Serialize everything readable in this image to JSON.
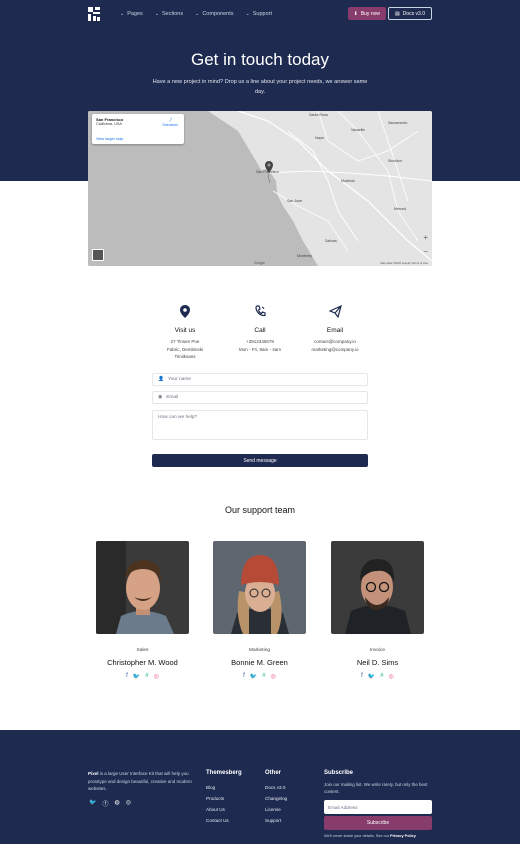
{
  "nav": {
    "links": [
      "Pages",
      "Sections",
      "Components",
      "Support"
    ],
    "buy_label": "Buy now",
    "docs_label": "Docs v3.0"
  },
  "hero": {
    "title": "Get in touch today",
    "subtitle": "Have a new project in mind? Drop us a line about your project needs, we answer same day."
  },
  "map": {
    "card_title": "San Francisco",
    "card_sub": "California, USA",
    "card_link": "View larger map",
    "directions": "Directions",
    "cities": [
      "Santa Rosa",
      "Sacramento",
      "Napa",
      "Vacaville",
      "Stockton",
      "San Francisco",
      "Modesto",
      "San Jose",
      "Merced",
      "Salinas",
      "Monterey"
    ],
    "footer": "Map data ©2020 Google   Terms of Use",
    "google": "Google"
  },
  "contact": {
    "visit": {
      "title": "Visit us",
      "lines": [
        "27 Tinsen Poe",
        "Fabric, Dembinski",
        "Timiiksans"
      ]
    },
    "call": {
      "title": "Call",
      "lines": [
        "+3912345678",
        "Mon - Fri, 8am - 4am"
      ]
    },
    "email": {
      "title": "Email",
      "lines": [
        "contact@company.io",
        "marketing@company.io"
      ]
    }
  },
  "form": {
    "name_placeholder": "Your name",
    "email_placeholder": "Email",
    "message_placeholder": "How can we help?",
    "send_label": "Send message"
  },
  "team": {
    "title": "Our support team",
    "members": [
      {
        "role": "Sales",
        "name": "Christopher M. Wood"
      },
      {
        "role": "Marketing",
        "name": "Bonnie M. Green"
      },
      {
        "role": "Invoice",
        "name": "Neil D. Sims"
      }
    ]
  },
  "footer": {
    "brand": "Pixel",
    "about": "is a large User Interface Kit that will help you prototype and design beautiful, creative and modern websites.",
    "col1": {
      "title": "Themesberg",
      "links": [
        "Blog",
        "Products",
        "About Us",
        "Contact Us"
      ]
    },
    "col2": {
      "title": "Other",
      "links": [
        "Docs  v3.0",
        "Changelog",
        "License",
        "Support"
      ]
    },
    "subscribe": {
      "title": "Subscribe",
      "text": "Join our mailing list. We write rarely, but only the best content.",
      "placeholder": "Email Address",
      "button": "Subscribe",
      "note": "We'll never share your details. See our",
      "policy": "Privacy Policy"
    }
  },
  "colors": {
    "navy": "#1e2a4f",
    "accent": "#883c6c"
  }
}
